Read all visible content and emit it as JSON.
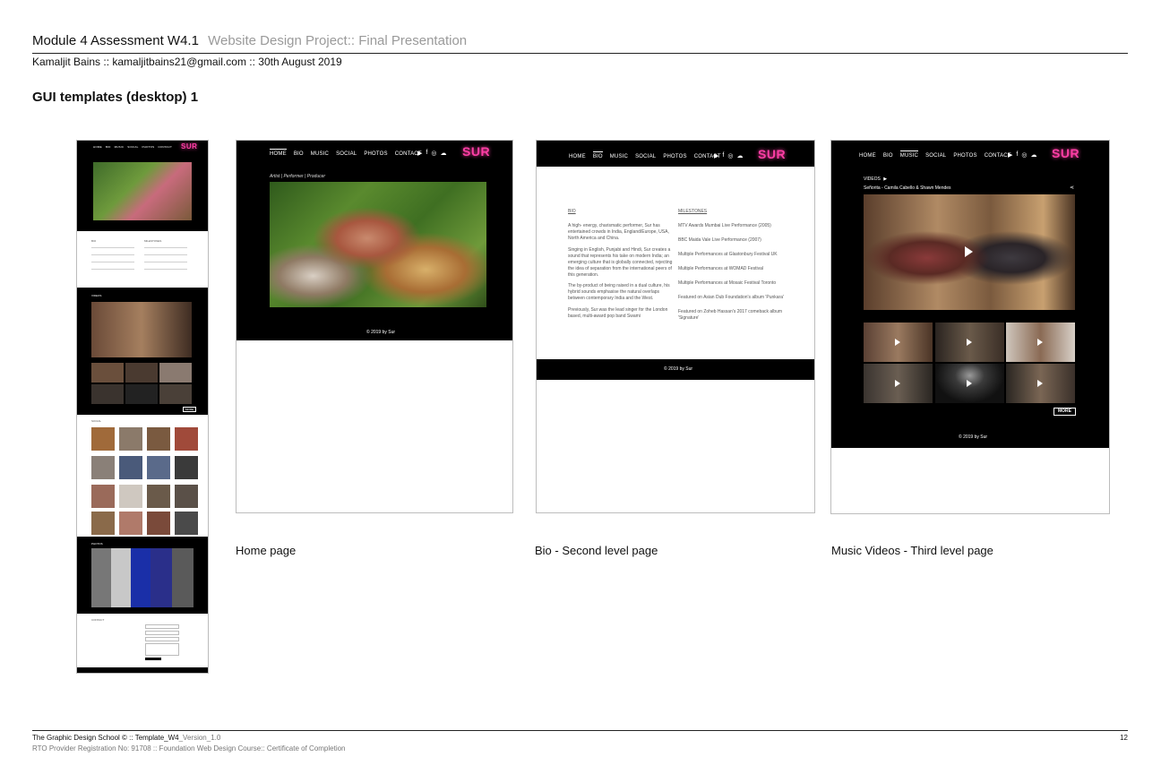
{
  "header": {
    "title": "Module 4 Assessment W4.1",
    "subtitle": "Website Design Project:: Final Presentation",
    "author": "Kamaljit Bains :: kamaljitbains21@gmail.com  ::  30th August 2019",
    "section": "GUI templates (desktop) 1"
  },
  "captions": {
    "home": "Home page",
    "bio": "Bio - Second level page",
    "music": "Music Videos - Third level page"
  },
  "footer": {
    "line1_a": "The Graphic Design School © ::  Template_W4",
    "line1_b": "_Version_1.0",
    "line2": "RTO Provider Registration No: 91708  ::  Foundation Web Design Course:: Certificate of Completion",
    "page_number": "12"
  },
  "site": {
    "nav": [
      "HOME",
      "BIO",
      "MUSIC",
      "SOCIAL",
      "PHOTOS",
      "CONTACT"
    ],
    "logo": "SUR",
    "copyright": "© 2019 by Sur",
    "tagline": "Artist | Performer | Producer",
    "more": "MORE",
    "videos_heading": "VIDEOS",
    "video_title": "Señorita - Camila Cabello & Shawn Mendes",
    "contact_heading": "CONTACT",
    "send": "SEND",
    "photos_heading": "PHOTOS",
    "social_heading": "SOCIAL"
  },
  "bio": {
    "heading": "BIO",
    "paragraphs": [
      "A high- energy, charismatic performer, Sur has entertained crowds in India, England/Europe, USA, North America and China.",
      "Singing in English, Punjabi and Hindi, Sur creates a sound that represents his take on modern India; an emerging culture that is globally connected, rejecting the idea of separation from the international peers of this generation.",
      "The by-product of being raised in a dual culture, his hybrid sounds emphasise the natural overlaps between contemporary India and the West.",
      "Previously, Sur was the lead singer for the London based, multi-award pop band Swami"
    ],
    "milestones_heading": "MILESTONES",
    "milestones": [
      "MTV Awards Mumbai Live Performance (2005)",
      "BBC Maida Vale Live Performance (2007)",
      "Multiple Performances at Glastonbury Festival UK",
      "Multiple Performances at WOMAD Festival",
      "Multiple Performances at Mosaic Festival Toronto",
      "Featured on Asian Dub Foundation's album 'Punkara'",
      "Featured on Zoheb Hassan's 2017 comeback album 'Signature'"
    ]
  },
  "contact": {
    "fields": [
      "Name",
      "Email",
      "Phone",
      "Message"
    ]
  },
  "colors": {
    "logo_pink": "#ff3ea5",
    "subtitle_grey": "#9a9a9a"
  }
}
